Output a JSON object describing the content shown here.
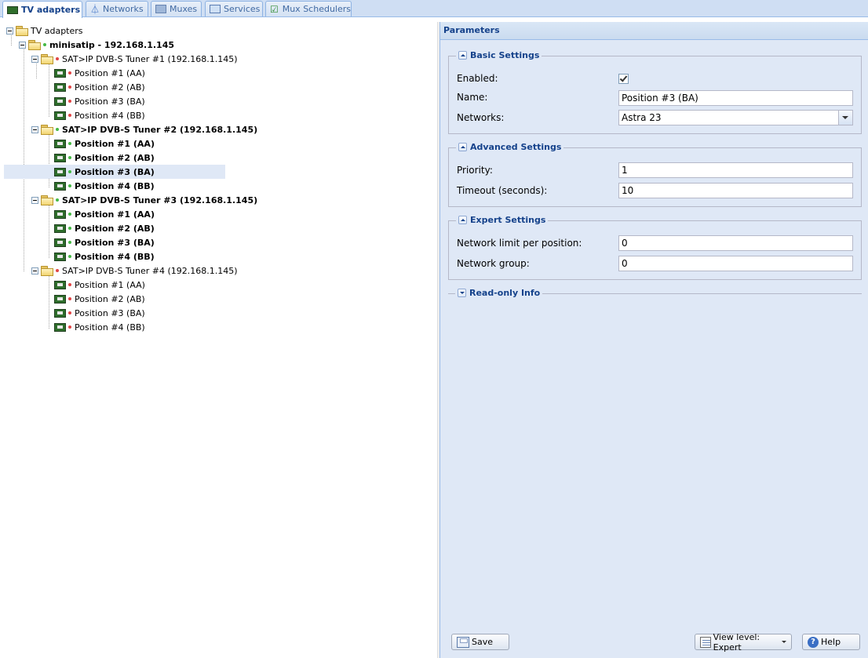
{
  "tabs": [
    {
      "label": "TV adapters",
      "icon": "tv-adapter-icon",
      "active": true
    },
    {
      "label": "Networks",
      "icon": "antenna-icon"
    },
    {
      "label": "Muxes",
      "icon": "mux-icon"
    },
    {
      "label": "Services",
      "icon": "services-icon"
    },
    {
      "label": "Mux Schedulers",
      "icon": "scheduler-icon"
    }
  ],
  "tree": {
    "root": "TV adapters",
    "device": "minisatip - 192.168.1.145",
    "tuners": [
      {
        "label": "SAT>IP DVB-S Tuner #1 (192.168.1.145)",
        "enabled": false,
        "positions": [
          "Position #1 (AA)",
          "Position #2 (AB)",
          "Position #3 (BA)",
          "Position #4 (BB)"
        ]
      },
      {
        "label": "SAT>IP DVB-S Tuner #2 (192.168.1.145)",
        "enabled": true,
        "positions": [
          "Position #1 (AA)",
          "Position #2 (AB)",
          "Position #3 (BA)",
          "Position #4 (BB)"
        ]
      },
      {
        "label": "SAT>IP DVB-S Tuner #3 (192.168.1.145)",
        "enabled": true,
        "positions": [
          "Position #1 (AA)",
          "Position #2 (AB)",
          "Position #3 (BA)",
          "Position #4 (BB)"
        ]
      },
      {
        "label": "SAT>IP DVB-S Tuner #4 (192.168.1.145)",
        "enabled": false,
        "positions": [
          "Position #1 (AA)",
          "Position #2 (AB)",
          "Position #3 (BA)",
          "Position #4 (BB)"
        ]
      }
    ],
    "selected": "Position #3 (BA)"
  },
  "params": {
    "title": "Parameters",
    "basic": {
      "legend": "Basic Settings",
      "enabled_label": "Enabled:",
      "enabled": true,
      "name_label": "Name:",
      "name_value": "Position #3 (BA)",
      "networks_label": "Networks:",
      "networks_value": "Astra 23"
    },
    "advanced": {
      "legend": "Advanced Settings",
      "priority_label": "Priority:",
      "priority_value": "1",
      "timeout_label": "Timeout (seconds):",
      "timeout_value": "10"
    },
    "expert": {
      "legend": "Expert Settings",
      "netlimit_label": "Network limit per position:",
      "netlimit_value": "0",
      "netgroup_label": "Network group:",
      "netgroup_value": "0"
    },
    "readonly": {
      "legend": "Read-only Info"
    }
  },
  "buttons": {
    "save": "Save",
    "view_level": "View level: Expert",
    "help": "Help"
  },
  "colors": {
    "panel_bg": "#dfe8f6",
    "header_text": "#15428b",
    "status_on": "#46b946",
    "status_off": "#e04545"
  }
}
